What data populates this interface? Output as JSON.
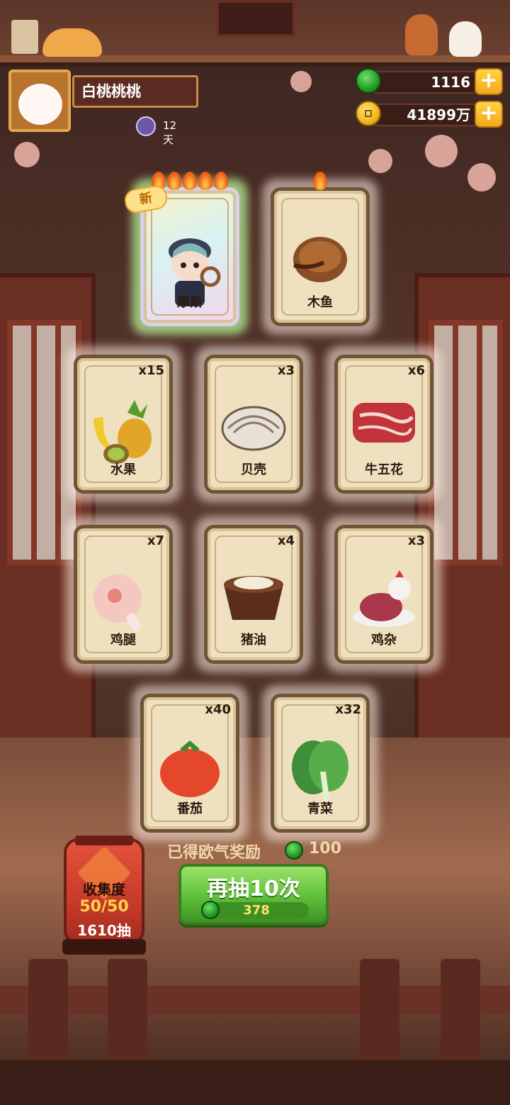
{
  "profile": {
    "name": "白桃桃桃",
    "days": "12天"
  },
  "currency": {
    "jade": "1116",
    "coins": "41899万"
  },
  "cards": [
    {
      "name": "摩斯",
      "count": "",
      "new_tag": "新",
      "flames": 5,
      "rarity": "rainbow",
      "icon": "character-detective-icon"
    },
    {
      "name": "木鱼",
      "count": "",
      "flames": 1,
      "icon": "wooden-fish-icon"
    },
    {
      "name": "水果",
      "count": "x15",
      "icon": "fruit-icon"
    },
    {
      "name": "贝壳",
      "count": "x3",
      "icon": "shell-icon"
    },
    {
      "name": "牛五花",
      "count": "x6",
      "icon": "beef-icon"
    },
    {
      "name": "鸡腿",
      "count": "x7",
      "icon": "drumstick-icon"
    },
    {
      "name": "猪油",
      "count": "x4",
      "icon": "lard-icon"
    },
    {
      "name": "鸡杂",
      "count": "x3",
      "icon": "chicken-giblets-icon"
    },
    {
      "name": "番茄",
      "count": "x40",
      "icon": "tomato-icon"
    },
    {
      "name": "青菜",
      "count": "x32",
      "icon": "greens-icon"
    }
  ],
  "reward": {
    "label": "已得欧气奖励",
    "value": "100"
  },
  "redraw": {
    "label": "再抽10次",
    "cost": "378"
  },
  "collection": {
    "title": "收集度",
    "progress": "50/50",
    "draws": "1610抽"
  },
  "colors": {
    "button_green": "#5fbf3a",
    "lantern_red": "#c73b2a",
    "card_bg": "#efe0bf"
  }
}
